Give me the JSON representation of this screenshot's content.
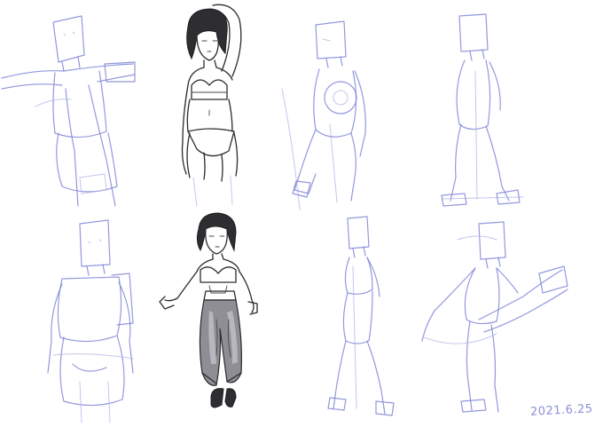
{
  "sheet": {
    "date": "2021.6.25"
  },
  "palette": {
    "sketch_blue": "#7f86d8",
    "sketch_blue_light": "#a9aee6",
    "ink": "#2b2b2e",
    "pants_grey": "#8e8e94",
    "background": "#ffffff"
  }
}
